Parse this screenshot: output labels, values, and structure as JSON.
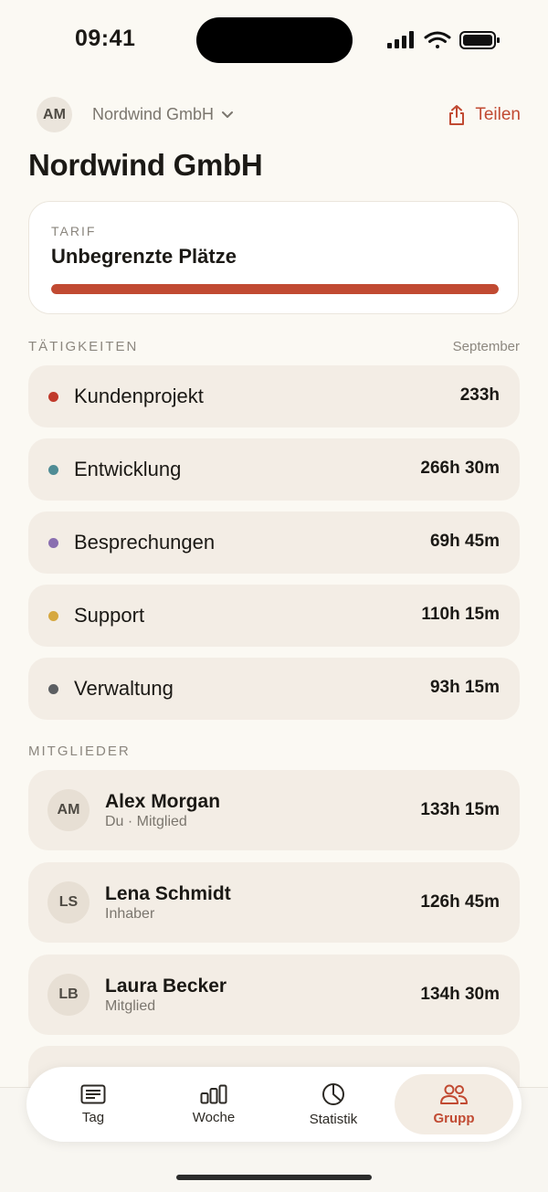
{
  "status_bar": {
    "time": "09:41"
  },
  "header": {
    "avatar_initials": "AM",
    "org_switcher_label": "Nordwind GmbH",
    "share_label": "Teilen"
  },
  "page_title": "Nordwind GmbH",
  "plan": {
    "label": "TARIF",
    "name": "Unbegrenzte Plätze",
    "usage_fraction": 1.0,
    "bar_color": "#c14a32"
  },
  "activities": {
    "heading": "TÄTIGKEITEN",
    "period": "September",
    "items": [
      {
        "name": "Kundenprojekt",
        "value": "233h",
        "color": "#c03a2b"
      },
      {
        "name": "Entwicklung",
        "value": "266h 30m",
        "color": "#4f8c95"
      },
      {
        "name": "Besprechungen",
        "value": "69h 45m",
        "color": "#8a6fb0"
      },
      {
        "name": "Support",
        "value": "110h 15m",
        "color": "#d6a840"
      },
      {
        "name": "Verwaltung",
        "value": "93h 15m",
        "color": "#5c5f62"
      }
    ]
  },
  "members": {
    "heading": "MITGLIEDER",
    "items": [
      {
        "initials": "AM",
        "name": "Alex Morgan",
        "role": "Du · Mitglied",
        "value": "133h 15m"
      },
      {
        "initials": "LS",
        "name": "Lena Schmidt",
        "role": "Inhaber",
        "value": "126h 45m"
      },
      {
        "initials": "LB",
        "name": "Laura Becker",
        "role": "Mitglied",
        "value": "134h 30m"
      }
    ]
  },
  "tab_bar": {
    "tabs": [
      {
        "label": "Tag",
        "icon": "day-list-icon"
      },
      {
        "label": "Woche",
        "icon": "week-bars-icon"
      },
      {
        "label": "Statistik",
        "icon": "pie-chart-icon"
      },
      {
        "label": "Grupp",
        "icon": "group-icon",
        "active": true
      }
    ],
    "accent_color": "#c14a32"
  }
}
